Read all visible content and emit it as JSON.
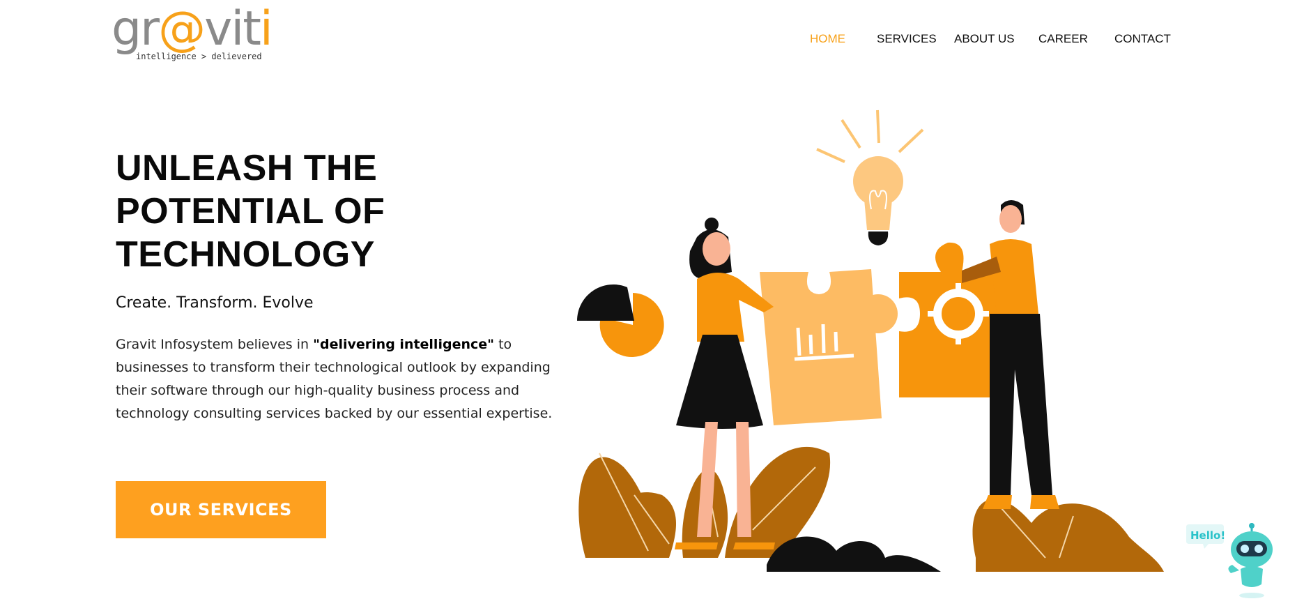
{
  "brand": {
    "logo_prefix": "gr",
    "logo_at": "@",
    "logo_suffix": "vit",
    "logo_i": "i",
    "tagline": "intelligence > delievered",
    "accent_color": "#f7a11a"
  },
  "nav": {
    "items": [
      {
        "label": "HOME",
        "active": true
      },
      {
        "label": "SERVICES",
        "active": false
      },
      {
        "label": "ABOUT US",
        "active": false
      },
      {
        "label": "CAREER",
        "active": false
      },
      {
        "label": "CONTACT",
        "active": false
      }
    ]
  },
  "hero": {
    "title_lines": [
      "UNLEASH THE",
      "POTENTIAL OF",
      "TECHNOLOGY"
    ],
    "subtitle": "Create. Transform. Evolve",
    "desc_before": "Gravit Infosystem believes in ",
    "desc_bold": "\"delivering intelligence\"",
    "desc_after": " to businesses to transform their technological outlook by expanding their software through our high-quality business process and technology consulting services backed by our essential expertise.",
    "cta_label": "OUR SERVICES",
    "cta_color": "#fea01f"
  },
  "chatbot": {
    "bubble_text": "Hello!"
  }
}
